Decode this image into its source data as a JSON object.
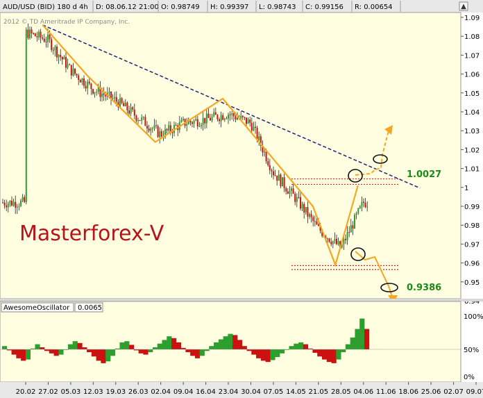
{
  "header": {
    "symbol": "AUD/USD (BID) 180 d 4h",
    "date": "D: 08.06.12 21:00",
    "open": "O: 0.98749",
    "high": "H: 0.99397",
    "low": "L: 0.98743",
    "close": "C: 0.99156",
    "range": "R: 0.00654"
  },
  "copyright": "2012 © TD Ameritrade IP Company, Inc.",
  "brand": "Masterforex-V",
  "level_labels": {
    "upper": "1.0027",
    "lower": "0.9386"
  },
  "indicator": {
    "name": "AwesomeOscillator",
    "value": "0.0065",
    "ticks": [
      "100%",
      "50%",
      "0%"
    ]
  },
  "colors": {
    "bg": "#fffee0",
    "up": "#2e9e2e",
    "down": "#cc1111",
    "pattern": "#f5a623",
    "trend": "#1a237e",
    "level": "#d92020"
  },
  "chart_data": {
    "type": "candlestick",
    "title": "AUD/USD (BID) 180 d 4h",
    "ylim": [
      0.935,
      1.093
    ],
    "y_ticks": [
      0.94,
      0.95,
      0.96,
      0.97,
      0.98,
      0.99,
      1.0,
      1.01,
      1.02,
      1.03,
      1.04,
      1.05,
      1.06,
      1.07,
      1.08,
      1.09
    ],
    "y_tick_labels": [
      "0.94",
      "0.95",
      "0.96",
      "0.97",
      "0.98",
      "0.99",
      "1",
      "1.01",
      "1.02",
      "1.03",
      "1.04",
      "1.05",
      "1.06",
      "1.07",
      "1.08",
      "1.09"
    ],
    "x_tick_labels": [
      "20.02",
      "27.02",
      "05.03",
      "12.03",
      "19.03",
      "26.03",
      "02.04",
      "09.04",
      "16.04",
      "23.04",
      "30.04",
      "07.05",
      "14.05",
      "21.05",
      "28.05",
      "04.06",
      "11.06",
      "18.06",
      "25.06",
      "02.07",
      "09.07"
    ],
    "price_path": [
      [
        "20.02",
        1.082
      ],
      [
        "27.02",
        1.078
      ],
      [
        "05.03",
        1.062
      ],
      [
        "12.03",
        1.052
      ],
      [
        "19.03",
        1.046
      ],
      [
        "26.03",
        1.037
      ],
      [
        "02.04",
        1.028
      ],
      [
        "09.04",
        1.034
      ],
      [
        "16.04",
        1.036
      ],
      [
        "23.04",
        1.039
      ],
      [
        "30.04",
        1.034
      ],
      [
        "07.05",
        1.008
      ],
      [
        "14.05",
        0.994
      ],
      [
        "21.05",
        0.978
      ],
      [
        "28.05",
        0.968
      ],
      [
        "04.06",
        0.992
      ]
    ],
    "pattern_points": [
      [
        "27.02",
        1.086
      ],
      [
        "12.03",
        1.059
      ],
      [
        "02.04",
        1.024
      ],
      [
        "23.04",
        1.047
      ],
      [
        "21.05",
        0.99
      ],
      [
        "28.05",
        0.959
      ],
      [
        "04.06",
        1.001
      ]
    ],
    "trendline": [
      [
        "27.02",
        1.086
      ],
      [
        "25.06",
        1.007
      ]
    ],
    "horizontal_levels": [
      1.0045,
      1.0016,
      0.9586,
      0.9565,
      0.9393
    ],
    "oscillator": {
      "ylim": [
        0,
        100
      ],
      "values": [
        52,
        45,
        38,
        32,
        28,
        30,
        48,
        55,
        50,
        44,
        40,
        36,
        38,
        46,
        55,
        60,
        57,
        50,
        42,
        35,
        28,
        24,
        27,
        36,
        48,
        58,
        60,
        54,
        45,
        40,
        38,
        42,
        50,
        56,
        62,
        68,
        65,
        58,
        49,
        42,
        36,
        32,
        36,
        44,
        52,
        58,
        63,
        68,
        72,
        70,
        62,
        52,
        44,
        38,
        32,
        28,
        26,
        29,
        34,
        40,
        46,
        52,
        56,
        58,
        55,
        48,
        41,
        35,
        30,
        26,
        24,
        30,
        42,
        55,
        66,
        80,
        97,
        80
      ]
    }
  }
}
